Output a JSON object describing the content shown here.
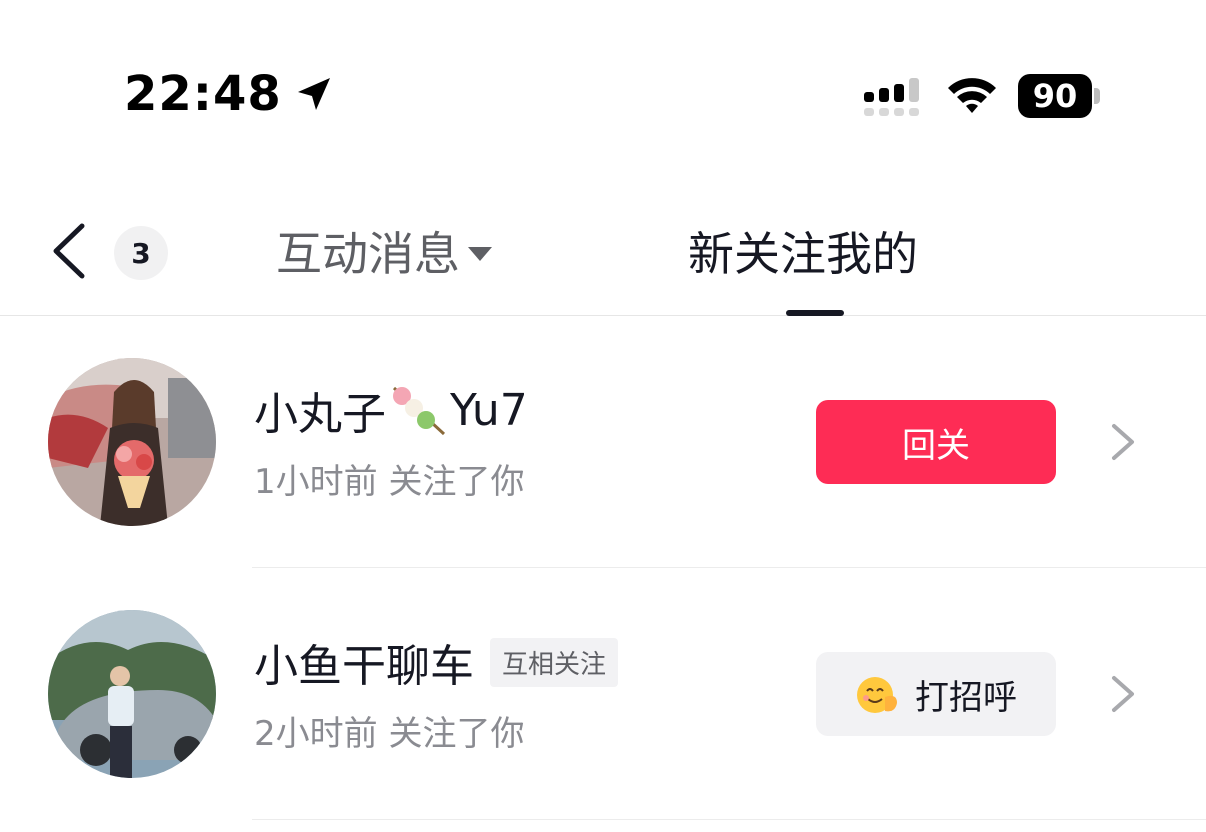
{
  "status_bar": {
    "time": "22:48",
    "battery": "90",
    "icons": [
      "location-arrow-icon",
      "signal-icon",
      "wifi-icon",
      "battery-icon"
    ]
  },
  "nav": {
    "back_icon": "chevron-left-icon",
    "badge_count": "3",
    "tab_interact": "互动消息",
    "tab_new_followers": "新关注我的",
    "active_tab": "新关注我的"
  },
  "followers": [
    {
      "name": "小丸子",
      "name_suffix": "Yu7",
      "name_emoji": "dango-icon",
      "subtitle": "1小时前 关注了你",
      "action": "回关",
      "tag": null
    },
    {
      "name": "小鱼干聊车",
      "tag": "互相关注",
      "subtitle": "2小时前 关注了你",
      "action": "打招呼",
      "action_emoji": "waving-smile-icon"
    }
  ],
  "colors": {
    "accent": "#fe2c55",
    "text_primary": "#161823",
    "text_secondary": "#8a8b91"
  }
}
